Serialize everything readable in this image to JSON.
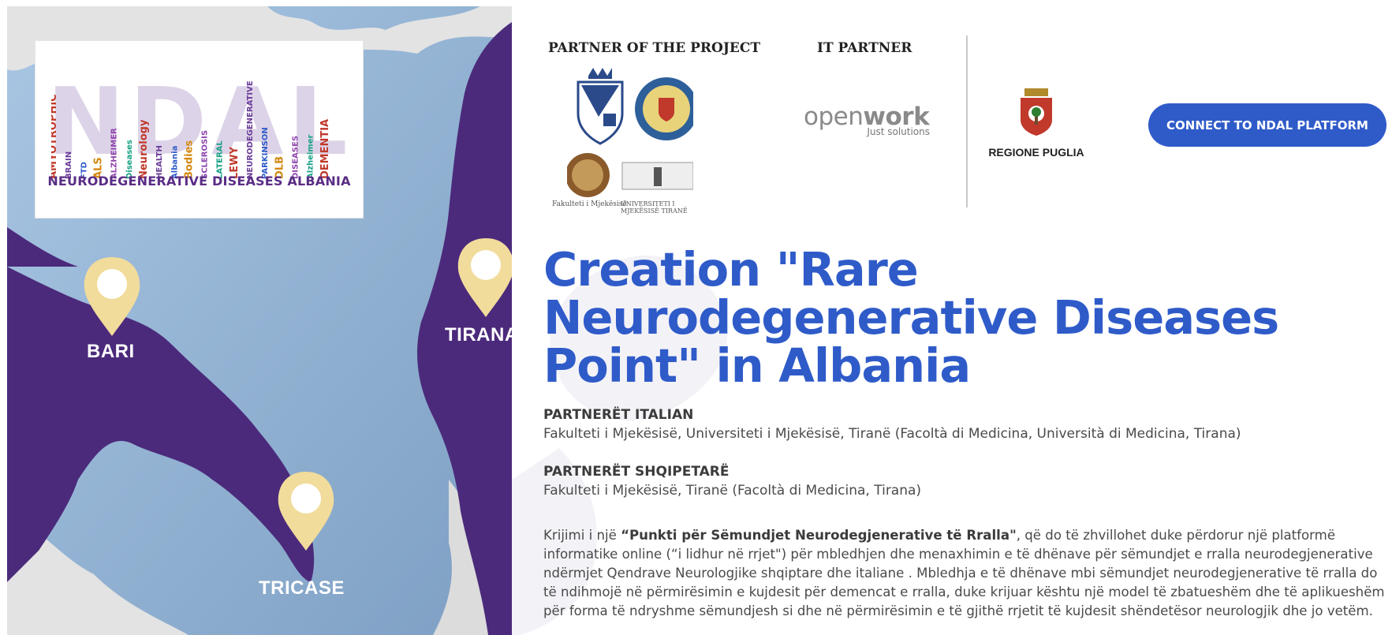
{
  "logo": {
    "acronym": "NDAL",
    "subtitle": "NEURODEGENERATIVE DISEASES ALBANIA",
    "words": [
      "AMYOTROPHIC",
      "BRAIN",
      "FTD",
      "ALS",
      "ALZHEIMER",
      "Diseases",
      "Neurology",
      "HEALTH",
      "Albania",
      "Bodies",
      "SCLEROSIS",
      "LATERAL",
      "LEWY",
      "NEURODEGENERATIVE",
      "PARKINSON",
      "DLB",
      "DISEASES",
      "Alzheimer",
      "DEMENTIA"
    ]
  },
  "map": {
    "cities": [
      "BARI",
      "TIRANA",
      "TRICASE"
    ]
  },
  "partners": {
    "project_heading": "PARTNER OF THE PROJECT",
    "it_heading": "IT PARTNER",
    "logo_captions": [
      "Fakulteti i Mjekësisë",
      "UNIVERSITETI I MJEKËSISË TIRANË"
    ],
    "openwork_name_a": "open",
    "openwork_name_b": "work",
    "openwork_tagline": "Just solutions",
    "regione_label": "REGIONE PUGLIA"
  },
  "cta": {
    "label": "CONNECT TO NDAL PLATFORM"
  },
  "main": {
    "title_lines": [
      "Creation \"Rare",
      "Neurodegenerative Diseases",
      "Point\" in Albania"
    ],
    "italian_heading": "PARTNERËT ITALIAN",
    "italian_text": "Fakulteti i Mjekësisë, Universiteti i Mjekësisë, Tiranë (Facoltà di Medicina, Università di Medicina, Tirana)",
    "albanian_heading": "PARTNERËT SHQIPETARË",
    "albanian_text": "Fakulteti i Mjekësisë, Tiranë (Facoltà di Medicina, Tirana)",
    "para_intro": "Krijimi i një ",
    "para_bold": "“Punkti për Sëmundjet Neurodegjenerative të Rralla\"",
    "para_rest": ", që do të zhvillohet duke përdorur një platformë informatike online (“i lidhur në rrjet\") për mbledhjen dhe menaxhimin e të dhënave për sëmundjet e rralla neurodegjenerative ndërmjet Qendrave Neurologjike shqiptare dhe italiane . Mbledhja e të dhënave mbi sëmundjet neurodegjenerative të rralla do të ndihmojë në përmirësimin e kujdesit për demencat e rralla, duke krijuar kështu një model të zbatueshëm dhe të aplikueshëm për forma të ndryshme sëmundjesh si dhe në përmirësimin e të gjithë rrjetit të kujdesit shëndetësor neurologjik dhe jo vetëm."
  },
  "colors": {
    "accent": "#2f5bc9",
    "land": "#4b2a7b",
    "sea": "#8fb0cf",
    "pin": "#f1dc9c"
  }
}
